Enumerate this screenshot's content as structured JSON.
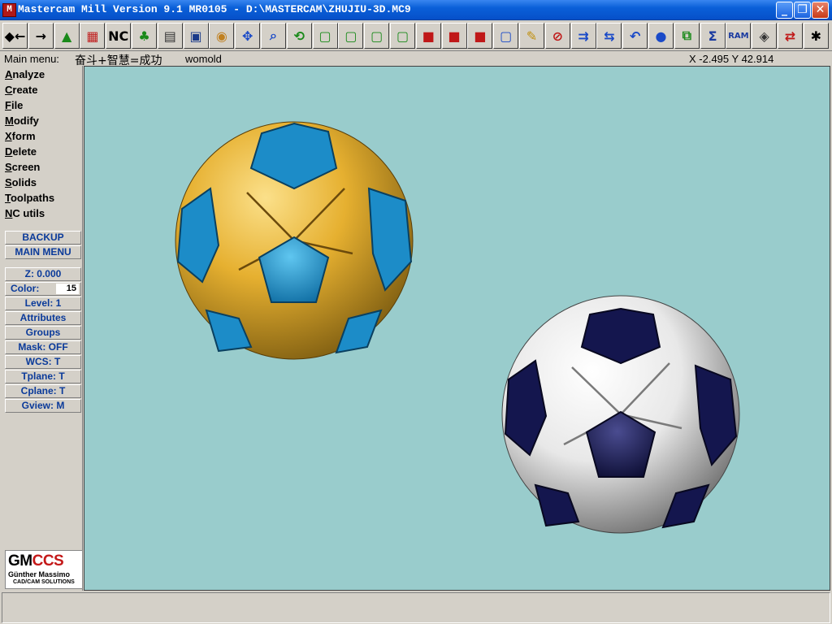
{
  "window": {
    "title": "Mastercam Mill Version 9.1 MR0105 - D:\\MASTERCAM\\ZHUJIU-3D.MC9",
    "app_icon_text": "M",
    "minimize": "_",
    "maximize": "❐",
    "close": "✕"
  },
  "toolbar": {
    "buttons": [
      {
        "name": "back",
        "icon": "◆←"
      },
      {
        "name": "forward",
        "icon": "→"
      },
      {
        "name": "mill",
        "icon": "▲"
      },
      {
        "name": "hsm",
        "icon": "▦"
      },
      {
        "name": "nc-data",
        "icon": "NC"
      },
      {
        "name": "tree",
        "icon": "♣"
      },
      {
        "name": "file-list",
        "icon": "▤"
      },
      {
        "name": "image",
        "icon": "▣"
      },
      {
        "name": "sphere-render",
        "icon": "◉"
      },
      {
        "name": "pan",
        "icon": "✥"
      },
      {
        "name": "zoom-window",
        "icon": "⌕"
      },
      {
        "name": "rotate-view",
        "icon": "⟲"
      },
      {
        "name": "cube-1",
        "icon": "▢"
      },
      {
        "name": "cube-2",
        "icon": "▢"
      },
      {
        "name": "cube-3",
        "icon": "▢"
      },
      {
        "name": "cube-4",
        "icon": "▢"
      },
      {
        "name": "cube-red-1",
        "icon": "■"
      },
      {
        "name": "cube-red-2",
        "icon": "■"
      },
      {
        "name": "cube-red-3",
        "icon": "■"
      },
      {
        "name": "cube-3d",
        "icon": "▢"
      },
      {
        "name": "eraser",
        "icon": "✎"
      },
      {
        "name": "no-entry",
        "icon": "⊘"
      },
      {
        "name": "arrange-1",
        "icon": "⇉"
      },
      {
        "name": "arrange-2",
        "icon": "⇆"
      },
      {
        "name": "undo",
        "icon": "↶"
      },
      {
        "name": "ball",
        "icon": "●"
      },
      {
        "name": "layers",
        "icon": "⧉"
      },
      {
        "name": "sum",
        "icon": "Σ"
      },
      {
        "name": "ram",
        "icon": "RAM"
      },
      {
        "name": "measure",
        "icon": "◈"
      },
      {
        "name": "catia",
        "icon": "⇄"
      },
      {
        "name": "run",
        "icon": "✱"
      }
    ]
  },
  "status": {
    "main_menu_label": "Main menu:",
    "main_menu_text": "奋斗+智慧=成功",
    "part_name": "womold",
    "coords": "X -2.495  Y 42.914"
  },
  "menu": {
    "items": [
      {
        "first": "A",
        "rest": "nalyze"
      },
      {
        "first": "C",
        "rest": "reate"
      },
      {
        "first": "F",
        "rest": "ile"
      },
      {
        "first": "M",
        "rest": "odify"
      },
      {
        "first": "X",
        "rest": "form"
      },
      {
        "first": "D",
        "rest": "elete"
      },
      {
        "first": "S",
        "rest": "creen"
      },
      {
        "first": "S",
        "rest": "olids"
      },
      {
        "first": "T",
        "rest": "oolpaths"
      },
      {
        "first": "N",
        "rest": "C utils"
      }
    ],
    "backup": "BACKUP",
    "main_menu": "MAIN MENU"
  },
  "secondary": {
    "z": "Z:  0.000",
    "color_label": "Color:",
    "color_value": "15",
    "level": "Level:  1",
    "attributes": "Attributes",
    "groups": "Groups",
    "mask": "Mask:  OFF",
    "wcs": "WCS:   T",
    "tplane": "Tplane:  T",
    "cplane": "Cplane:  T",
    "gview": "Gview:   M"
  },
  "logo": {
    "gm": "GM",
    "ccs": "CCS",
    "line1": "Günther Massimo",
    "line2": "CAD/CAM SOLUTIONS"
  },
  "colors": {
    "viewport_bg": "#99cccc",
    "ball1_panel": "#e6b030",
    "ball1_patch": "#1c8cc8",
    "ball2_panel": "#f2f2f2",
    "ball2_patch": "#14164e",
    "menu_text_blue": "#0a3a9a"
  },
  "prompt": {
    "text": ""
  }
}
